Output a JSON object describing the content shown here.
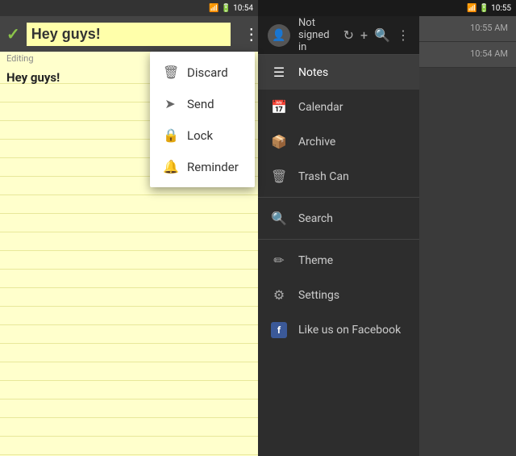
{
  "left": {
    "statusBar": {
      "icons": "📶 🔋 10:54"
    },
    "toolbar": {
      "checkLabel": "✓",
      "noteTitle": "Hey guys!",
      "menuIcon": "⋮"
    },
    "editingLabel": "Editing",
    "noteText": "Hey guys!",
    "dropdown": {
      "items": [
        {
          "id": "discard",
          "icon": "🗑",
          "label": "Discard"
        },
        {
          "id": "send",
          "icon": "➤",
          "label": "Send"
        },
        {
          "id": "lock",
          "icon": "🔒",
          "label": "Lock"
        },
        {
          "id": "reminder",
          "icon": "🔔",
          "label": "Reminder"
        }
      ]
    }
  },
  "right": {
    "statusBar": {
      "icons": "📶 🔋 10:55"
    },
    "sidebar": {
      "header": {
        "notSignedIn": "Not signed in",
        "refreshIcon": "↻",
        "addIcon": "+",
        "searchIcon": "🔍",
        "moreIcon": "⋮"
      },
      "navItems": [
        {
          "id": "notes",
          "icon": "☰",
          "label": "Notes",
          "active": true
        },
        {
          "id": "calendar",
          "icon": "📅",
          "label": "Calendar",
          "active": false
        },
        {
          "id": "archive",
          "icon": "📦",
          "label": "Archive",
          "active": false
        },
        {
          "id": "trash",
          "icon": "🗑",
          "label": "Trash Can",
          "active": false
        },
        {
          "id": "search",
          "icon": "🔍",
          "label": "Search",
          "active": false
        },
        {
          "id": "theme",
          "icon": "✏",
          "label": "Theme",
          "active": false
        },
        {
          "id": "settings",
          "icon": "⚙",
          "label": "Settings",
          "active": false
        },
        {
          "id": "facebook",
          "icon": "f",
          "label": "Like us on Facebook",
          "active": false
        }
      ]
    },
    "notesList": {
      "items": [
        {
          "time": "10:55 AM",
          "preview": ""
        },
        {
          "time": "10:54 AM",
          "preview": ""
        }
      ]
    }
  }
}
